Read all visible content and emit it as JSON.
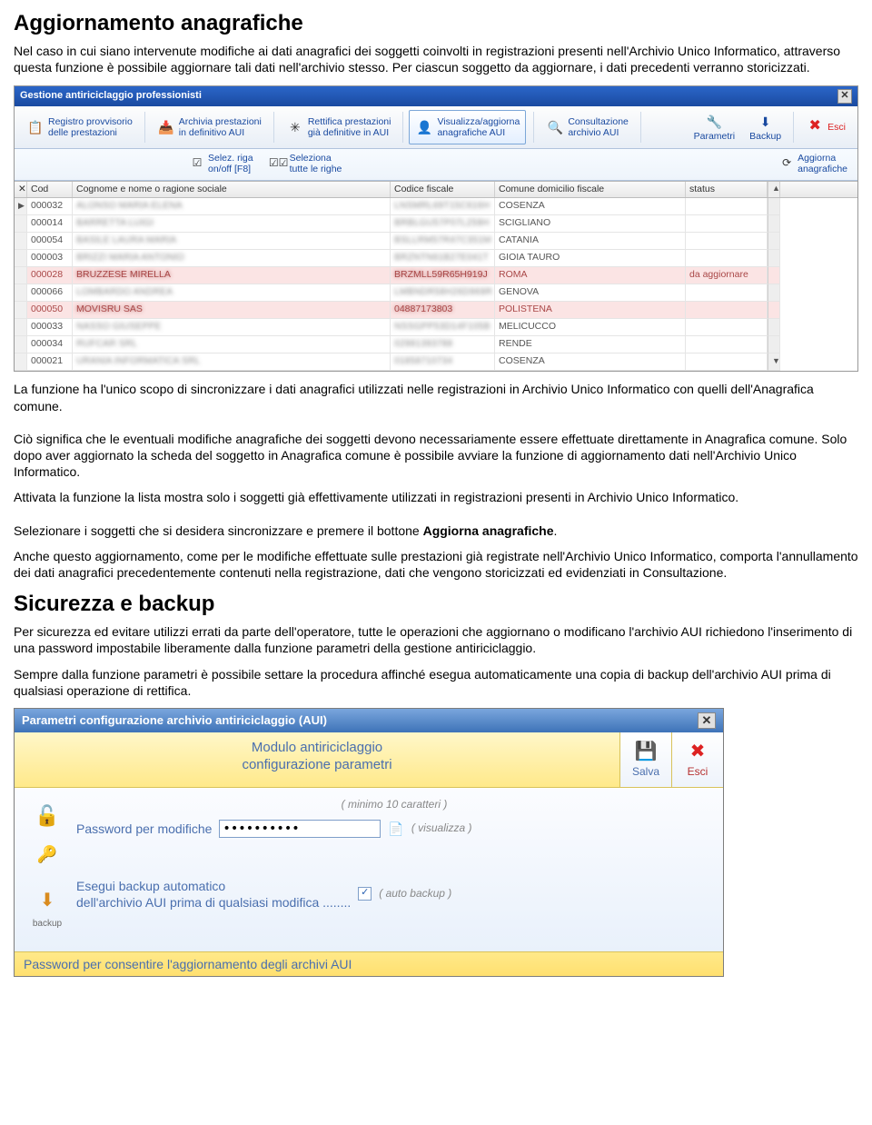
{
  "sections": {
    "s1_title": "Aggiornamento anagrafiche",
    "s1_p1": "Nel caso in cui siano intervenute modifiche ai dati anagrafici dei soggetti coinvolti in registrazioni presenti nell'Archivio Unico Informatico, attraverso questa funzione è possibile aggiornare tali dati nell'archivio stesso. Per ciascun soggetto da aggiornare, i dati precedenti verranno storicizzati.",
    "s1_p2": "La funzione ha l'unico scopo di sincronizzare i dati anagrafici utilizzati nelle registrazioni in Archivio Unico Informatico con quelli dell'Anagrafica comune.",
    "s1_p3": "Ciò significa che le eventuali modifiche anagrafiche dei soggetti devono necessariamente essere effettuate direttamente in Anagrafica comune. Solo dopo aver aggiornato la scheda del soggetto in Anagrafica comune è possibile avviare la funzione di aggiornamento dati nell'Archivio Unico Informatico.",
    "s1_p4": "Attivata la funzione la lista mostra solo i soggetti già effettivamente utilizzati in registrazioni presenti in Archivio Unico Informatico.",
    "s1_p5_a": "Selezionare i soggetti che si desidera sincronizzare e premere il bottone ",
    "s1_p5_b": "Aggiorna anagrafiche",
    "s1_p5_c": ".",
    "s1_p6": "Anche questo aggiornamento, come per le modifiche effettuate sulle prestazioni già registrate nell'Archivio Unico Informatico, comporta l'annullamento dei dati anagrafici precedentemente contenuti nella registrazione, dati che vengono storicizzati ed evidenziati in Consultazione.",
    "s2_title": "Sicurezza e backup",
    "s2_p1": "Per sicurezza ed evitare utilizzi errati da parte dell'operatore, tutte le operazioni che aggiornano o modificano l'archivio AUI richiedono l'inserimento di una password impostabile liberamente dalla funzione parametri della gestione antiriciclaggio.",
    "s2_p2": "Sempre dalla funzione parametri è possibile settare la procedura affinché esegua automaticamente una copia di backup dell'archivio AUI prima di qualsiasi operazione di rettifica."
  },
  "win1": {
    "title": "Gestione antiriciclaggio professionisti",
    "ribbon": [
      {
        "line1": "Registro provvisorio",
        "line2": "delle prestazioni",
        "icon": "📋"
      },
      {
        "line1": "Archivia prestazioni",
        "line2": "in definitivo AUI",
        "icon": "📥"
      },
      {
        "line1": "Rettifica prestazioni",
        "line2": "già definitive in AUI",
        "icon": "✳"
      },
      {
        "line1": "Visualizza/aggiorna",
        "line2": "anagrafiche AUI",
        "icon": "👤",
        "selected": true
      },
      {
        "line1": "Consultazione",
        "line2": "archivio AUI",
        "icon": "🔍"
      }
    ],
    "ribbon_right": [
      {
        "label": "Parametri",
        "icon": "🔧"
      },
      {
        "label": "Backup",
        "icon": "⬇"
      }
    ],
    "esci": "Esci",
    "subbar": [
      {
        "line1": "Selez. riga",
        "line2": "on/off [F8]",
        "icon": "☑"
      },
      {
        "line1": "Seleziona",
        "line2": "tutte le righe",
        "icon": "☑☑"
      }
    ],
    "subbar_right": {
      "line1": "Aggiorna",
      "line2": "anagrafiche",
      "icon": "⟳"
    },
    "columns": {
      "sel": "✕",
      "cod": "Cod",
      "nome": "Cognome e nome o ragione sociale",
      "cf": "Codice fiscale",
      "comune": "Comune domicilio fiscale",
      "status": "status"
    },
    "rows": [
      {
        "sel": "▶",
        "cod": "000032",
        "nome": "ALONSO MARIA ELENA",
        "cf": "LNSMRL69T15C616H",
        "comune": "COSENZA",
        "status": "",
        "hl": false
      },
      {
        "sel": "",
        "cod": "000014",
        "nome": "BARRETTA LUIGI",
        "cf": "BRBLGU57P07L259H",
        "comune": "SCIGLIANO",
        "status": "",
        "hl": false
      },
      {
        "sel": "",
        "cod": "000054",
        "nome": "BASILE LAURA MARIA",
        "cf": "BSLLRM57R47C351M",
        "comune": "CATANIA",
        "status": "",
        "hl": false
      },
      {
        "sel": "",
        "cod": "000003",
        "nome": "BRIZZI MARIA ANTONIO",
        "cf": "BRZNTN61B27E041T",
        "comune": "GIOIA TAURO",
        "status": "",
        "hl": false
      },
      {
        "sel": "",
        "cod": "000028",
        "nome": "BRUZZESE MIRELLA",
        "cf": "BRZMLL59R65H919J",
        "comune": "ROMA",
        "status": "da aggiornare",
        "hl": true
      },
      {
        "sel": "",
        "cod": "000066",
        "nome": "LOMBARDO ANDREA",
        "cf": "LMBNDR58H26D969R",
        "comune": "GENOVA",
        "status": "",
        "hl": false
      },
      {
        "sel": "",
        "cod": "000050",
        "nome": "MOVISRU SAS",
        "cf": "04887173803",
        "comune": "POLISTENA",
        "status": "",
        "hl": true,
        "sep": true
      },
      {
        "sel": "",
        "cod": "000033",
        "nome": "NASSO GIUSEPPE",
        "cf": "NSSGPP53D14F105B",
        "comune": "MELICUCCO",
        "status": "",
        "hl": false
      },
      {
        "sel": "",
        "cod": "000034",
        "nome": "RUFCAR SRL",
        "cf": "02981393788",
        "comune": "RENDE",
        "status": "",
        "hl": false
      },
      {
        "sel": "",
        "cod": "000021",
        "nome": "URANIA INFORMATICA SRL",
        "cf": "01858710734",
        "comune": "COSENZA",
        "status": "",
        "hl": false
      }
    ]
  },
  "win2": {
    "title": "Parametri configurazione archivio antiriciclaggio (AUI)",
    "hdr_line1": "Modulo antiriciclaggio",
    "hdr_line2": "configurazione parametri",
    "save": "Salva",
    "esci": "Esci",
    "hint": "( minimo 10 caratteri )",
    "pwd_label": "Password per modifiche",
    "pwd_value": "**********",
    "visualizza": "( visualizza )",
    "backup_line1": "Esegui backup automatico",
    "backup_line2": "dell'archivio AUI prima di qualsiasi modifica ........",
    "autobackup": "( auto backup )",
    "sidetab": "backup",
    "status": "Password per consentire l'aggiornamento degli archivi AUI"
  }
}
